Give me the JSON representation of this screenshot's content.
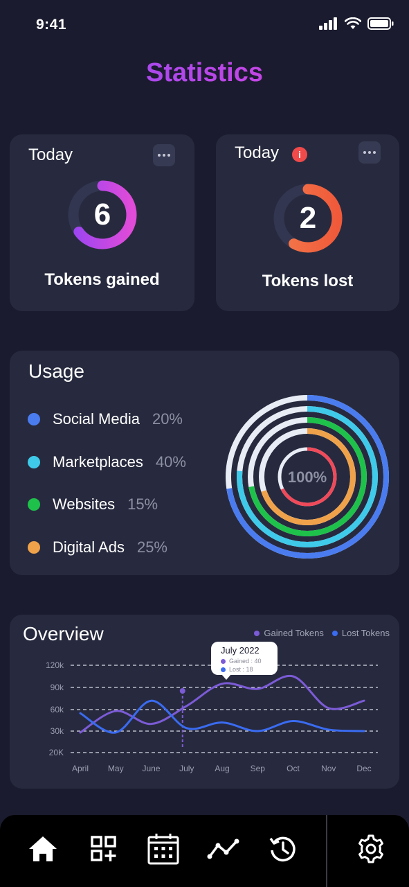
{
  "status": {
    "time": "9:41"
  },
  "title": "Statistics",
  "cards": {
    "gained": {
      "heading": "Today",
      "value": "6",
      "label": "Tokens gained",
      "progress": 0.65
    },
    "lost": {
      "heading": "Today",
      "info": "i",
      "value": "2",
      "label": "Tokens lost",
      "progress": 0.58
    }
  },
  "usage": {
    "title": "Usage",
    "center_label": "100%",
    "items": [
      {
        "name": "Social Media",
        "pct": "20%",
        "color": "#4a7cf0"
      },
      {
        "name": "Marketplaces",
        "pct": "40%",
        "color": "#3fcaea"
      },
      {
        "name": "Websites",
        "pct": "15%",
        "color": "#1ec24b"
      },
      {
        "name": "Digital Ads",
        "pct": "25%",
        "color": "#f0a24a"
      }
    ]
  },
  "overview": {
    "title": "Overview",
    "legend_gained": "Gained Tokens",
    "legend_lost": "Lost Tokens",
    "tooltip": {
      "title": "July 2022",
      "gained": "Gained : 40",
      "lost": "Lost : 18"
    }
  },
  "chart_data": {
    "type": "line",
    "title": "Overview",
    "categories": [
      "April",
      "May",
      "June",
      "July",
      "Aug",
      "Sep",
      "Oct",
      "Nov",
      "Dec"
    ],
    "y_ticks": [
      "120k",
      "90k",
      "60k",
      "30k",
      "20K"
    ],
    "series": [
      {
        "name": "Gained Tokens",
        "color": "#7b5bd6",
        "values": [
          28,
          58,
          40,
          65,
          95,
          88,
          105,
          62,
          72
        ]
      },
      {
        "name": "Lost Tokens",
        "color": "#3a6bf0",
        "values": [
          55,
          28,
          72,
          34,
          42,
          30,
          44,
          32,
          30
        ]
      }
    ],
    "grid": true,
    "legend": "top-right"
  },
  "nav": {
    "items": [
      "home-icon",
      "add-widget-icon",
      "calendar-icon",
      "analytics-icon",
      "history-icon"
    ],
    "settings": "gear-icon"
  }
}
